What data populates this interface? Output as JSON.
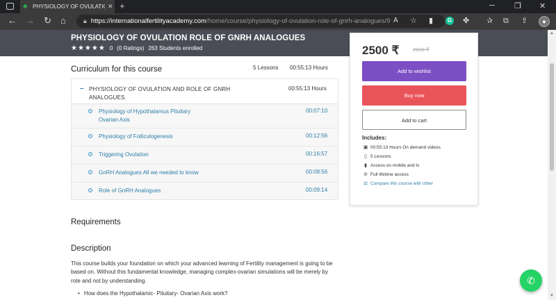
{
  "browser": {
    "tab_title": "PHYSIOLOGY OF OVULATION RO",
    "tab_close": "✕",
    "new_tab": "+",
    "url_host": "https://internationalfertilityacademy.com",
    "url_path": "/home/course/physiology-of-ovulation-role-of-gnrh-analogues/9"
  },
  "course": {
    "title": "PHYSIOLOGY OF OVULATION ROLE OF GNRH ANALOGUES",
    "stars": "★★★★★",
    "rating_value": "0",
    "ratings_count": "(0 Ratings)",
    "enrolled": "263 Students enrolled"
  },
  "curriculum": {
    "heading": "Curriculum for this course",
    "lessons_count": "5 Lessons",
    "total_duration": "00:55:13 Hours",
    "section": {
      "title": "PHYSIOLOGY OF OVULATION AND ROLE OF GNRH ANALOGUES.",
      "duration": "00:55:13 Hours",
      "lessons": [
        {
          "title": "Physiology of Hypothalamus Pituitary Ovarian Axis",
          "duration": "00:07:10"
        },
        {
          "title": "Physiology of Folliculogenesis",
          "duration": "00:12:56"
        },
        {
          "title": "Triggering Ovulation",
          "duration": "00:16:57"
        },
        {
          "title": "GnRH Analogues All we needed to know",
          "duration": "00:08:56"
        },
        {
          "title": "Role of GnRH Analogues",
          "duration": "00:09:14"
        }
      ]
    }
  },
  "requirements": {
    "heading": "Requirements"
  },
  "description": {
    "heading": "Description",
    "text": "This course builds your foundation on which your advanced learning of Fertility management is going to be based on. Without this fundamental knowledge, managing complex-ovarian simulations will be merely by rote and not by understanding.",
    "bullet": "How does the Hypothalamic- Pituitary- Ovarian Axis work?"
  },
  "card": {
    "price": "2500 ₹",
    "old_price": "2500 ₹",
    "wishlist_label": "Add to wishlist",
    "buy_label": "Buy now",
    "cart_label": "Add to cart",
    "includes_heading": "Includes:",
    "includes": [
      "00:55:13 Hours On demand videos",
      "5 Lessons",
      "Access on mobile and tv",
      "Full lifetime access",
      "Compare this course with other"
    ]
  },
  "colors": {
    "wishlist": "#7c4fc4",
    "buy": "#e9545b",
    "link": "#2d7ea8",
    "hero": "#4a4d55",
    "whatsapp": "#25d366"
  }
}
